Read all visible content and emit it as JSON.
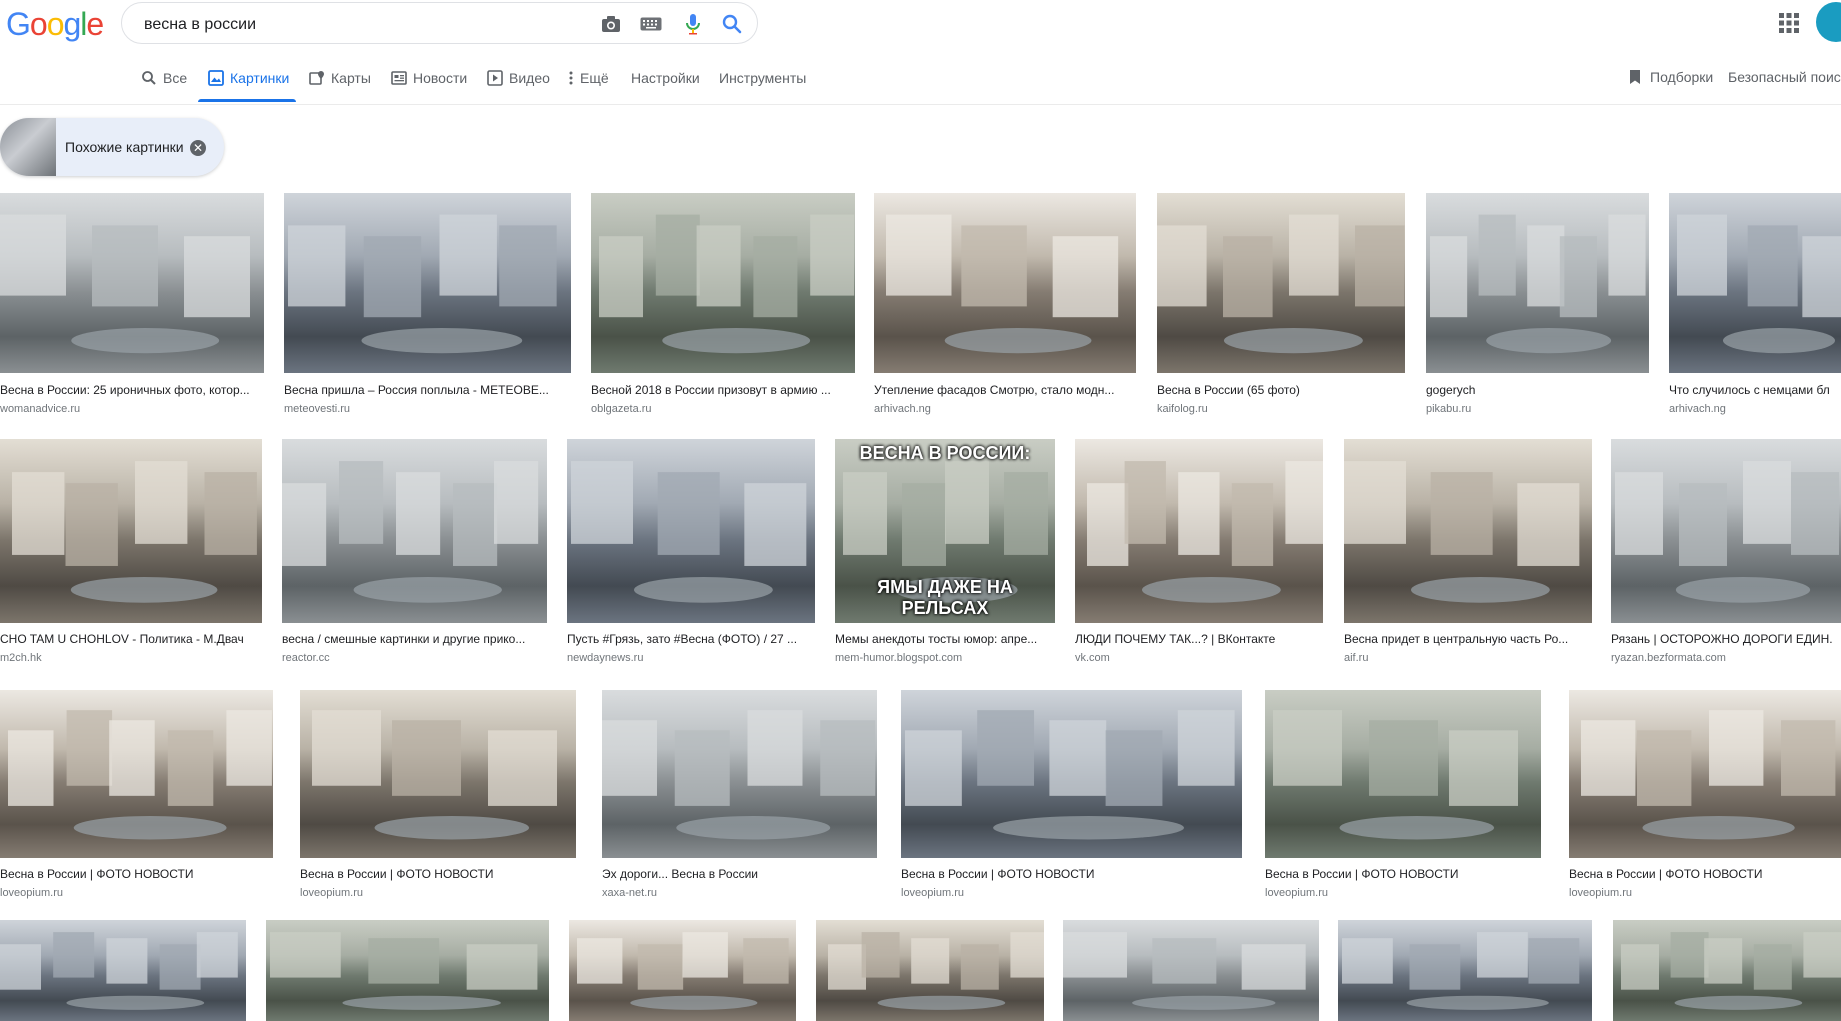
{
  "logo": {
    "letters": [
      "G",
      "o",
      "o",
      "g",
      "l",
      "e"
    ],
    "colors": [
      "#4285f4",
      "#ea4335",
      "#fbbc05",
      "#4285f4",
      "#34a853",
      "#ea4335"
    ]
  },
  "search": {
    "value": "весна в россии"
  },
  "icons": {
    "camera": "camera-icon",
    "keyboard": "keyboard-icon",
    "mic": "mic-icon",
    "search": "search-icon",
    "apps": "apps-grid-icon"
  },
  "tabs": [
    {
      "label": "Все",
      "icon": "search-icon"
    },
    {
      "label": "Картинки",
      "icon": "image-icon",
      "active": true
    },
    {
      "label": "Карты",
      "icon": "map-icon"
    },
    {
      "label": "Новости",
      "icon": "news-icon"
    },
    {
      "label": "Видео",
      "icon": "video-icon"
    },
    {
      "label": "Ещё",
      "icon": "more-vert-icon"
    },
    {
      "label": "Настройки"
    },
    {
      "label": "Инструменты"
    }
  ],
  "right_tabs": {
    "collections": "Подборки",
    "safe_search": "Безопасный поиск"
  },
  "similar_chip": {
    "label": "Похожие картинки"
  },
  "results": [
    {
      "caption": "Весна в России: 25 ироничных фото, котор...",
      "source": "womanadvice.ru"
    },
    {
      "caption": "Весна пришла – Россия поплыла - METEOBE...",
      "source": "meteovesti.ru"
    },
    {
      "caption": "Весной 2018 в России призовут в армию ...",
      "source": "oblgazeta.ru"
    },
    {
      "caption": "Утепление фасадов Смотрю, стало модн...",
      "source": "arhivach.ng"
    },
    {
      "caption": "Весна в России (65 фото)",
      "source": "kaifolog.ru"
    },
    {
      "caption": "gogerych",
      "source": "pikabu.ru"
    },
    {
      "caption": "Что случилось с немцами бл",
      "source": "arhivach.ng"
    },
    {
      "caption": "CHO TAM U CHOHLOV - Политика - М.Двач",
      "source": "m2ch.hk"
    },
    {
      "caption": "весна / смешные картинки и другие прико...",
      "source": "reactor.cc"
    },
    {
      "caption": "Пусть #Грязь, зато #Весна (ФОТО) / 27 ...",
      "source": "newdaynews.ru"
    },
    {
      "caption": "Мемы анекдоты тосты юмор: апре...",
      "source": "mem-humor.blogspot.com",
      "overlay_top": "ВЕСНА В РОССИИ:",
      "overlay_bottom": "ЯМЫ ДАЖЕ НА РЕЛЬСАХ"
    },
    {
      "caption": "ЛЮДИ ПОЧЕМУ ТАК...? | ВКонтакте",
      "source": "vk.com"
    },
    {
      "caption": "Весна придет в центральную часть Ро...",
      "source": "aif.ru"
    },
    {
      "caption": "Рязань | ОСТОРОЖНО ДОРОГИ ЕДИН.",
      "source": "ryazan.bezformata.com"
    },
    {
      "caption": "Весна в России | ФОТО НОВОСТИ",
      "source": "loveopium.ru"
    },
    {
      "caption": "Весна в России | ФОТО НОВОСТИ",
      "source": "loveopium.ru"
    },
    {
      "caption": "Эх дороги... Весна в России",
      "source": "xaxa-net.ru"
    },
    {
      "caption": "Весна в России | ФОТО НОВОСТИ",
      "source": "loveopium.ru"
    },
    {
      "caption": "Весна в России | ФОТО НОВОСТИ",
      "source": "loveopium.ru"
    },
    {
      "caption": "Весна в России | ФОТО НОВОСТИ",
      "source": "loveopium.ru"
    },
    {
      "caption": "",
      "source": ""
    },
    {
      "caption": "",
      "source": ""
    },
    {
      "caption": "",
      "source": ""
    },
    {
      "caption": "",
      "source": ""
    },
    {
      "caption": "",
      "source": ""
    },
    {
      "caption": "",
      "source": ""
    },
    {
      "caption": "",
      "source": ""
    }
  ]
}
